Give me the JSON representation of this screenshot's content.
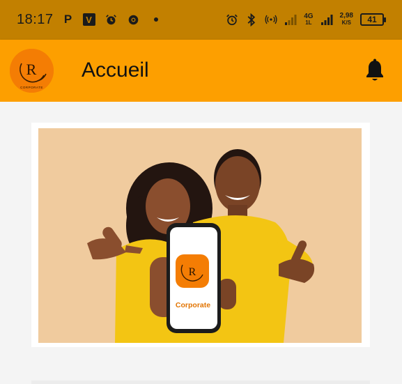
{
  "status_bar": {
    "time": "18:17",
    "left_icons": [
      "p-notification-icon",
      "v-app-icon",
      "alarm-icon",
      "chrome-icon"
    ],
    "network_type": "4G",
    "network_sub": "1L",
    "speed_value": "2,98",
    "speed_unit": "K/S",
    "battery_level": "41"
  },
  "app_bar": {
    "title": "Accueil",
    "logo_letter": "R",
    "logo_caption": "CORPORATE",
    "notification_icon": "bell-icon"
  },
  "banner": {
    "phone_label": "Corporate",
    "phone_logo_letter": "R",
    "description": "promotional-photo"
  },
  "colors": {
    "status_bar": "#c28000",
    "app_bar": "#fd9f00",
    "brand_orange": "#f47d04",
    "background": "#f4f4f4"
  }
}
